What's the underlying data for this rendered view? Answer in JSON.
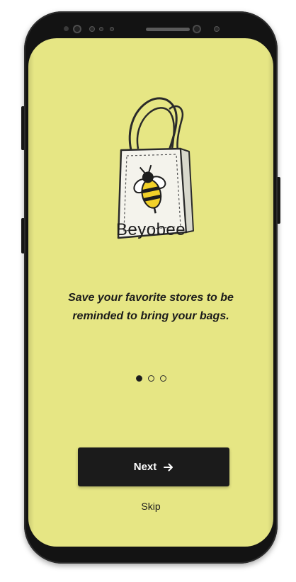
{
  "app": {
    "brand_name": "Beyobee",
    "logo_icon": "bee-tote-bag-icon"
  },
  "onboarding": {
    "message": "Save your favorite stores to be reminded to bring your bags.",
    "pager": {
      "current_page": 1,
      "total_pages": 3
    },
    "next_button": {
      "label": "Next",
      "icon": "arrow-right-icon"
    },
    "skip_label": "Skip"
  },
  "colors": {
    "screen_background": "#e6e684",
    "button_background": "#1b1b1b",
    "button_text": "#ffffff",
    "text_primary": "#1b1b1b"
  }
}
